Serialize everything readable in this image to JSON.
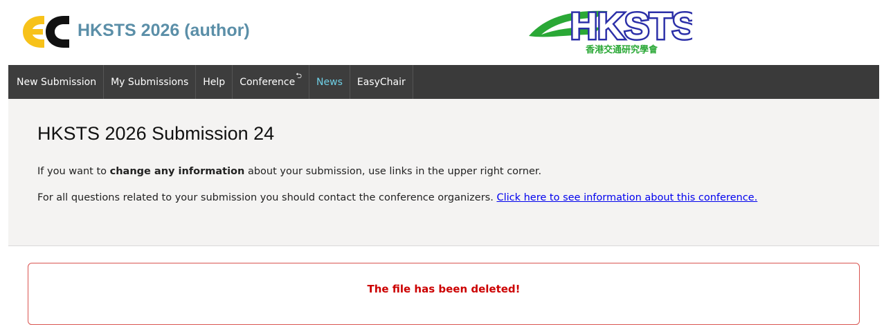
{
  "header": {
    "app_title": "HKSTS 2026 (author)",
    "logo_left": "EasyChair logo",
    "logo_right": {
      "name": "HKSTS",
      "chinese": "香港交通研究學會",
      "color_blue": "#2b2fa8",
      "color_green": "#2aa836"
    }
  },
  "nav": {
    "items": [
      {
        "label": "New Submission"
      },
      {
        "label": "My Submissions"
      },
      {
        "label": "Help"
      },
      {
        "label": "Conference",
        "icon": "return-icon"
      },
      {
        "label": "News",
        "active": true
      },
      {
        "label": "EasyChair"
      }
    ],
    "active_color": "#6fd0e6"
  },
  "main": {
    "title": "HKSTS 2026 Submission 24",
    "line1": {
      "before": "If you want to ",
      "bold": "change any information",
      "after": " about your submission, use links in the upper right corner."
    },
    "line2": {
      "text": "For all questions related to your submission you should contact the conference organizers. ",
      "link": "Click here to see information about this conference."
    }
  },
  "alert": {
    "message": "The file has been deleted!",
    "color": "#cc0000"
  }
}
